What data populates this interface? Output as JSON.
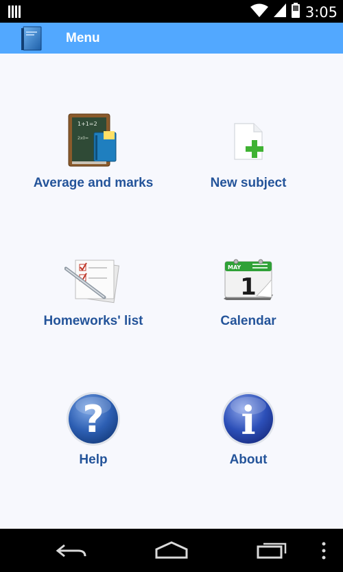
{
  "status_bar": {
    "time": "3:05",
    "icons": [
      "notification-icon",
      "wifi-icon",
      "signal-icon",
      "battery-icon"
    ]
  },
  "action_bar": {
    "title": "Menu",
    "icon": "book-icon",
    "color": "#52a8ff"
  },
  "menu": {
    "items": [
      {
        "label": "Average and marks",
        "icon": "chalkboard-icon"
      },
      {
        "label": "New subject",
        "icon": "add-document-icon"
      },
      {
        "label": "Homeworks' list",
        "icon": "checklist-icon"
      },
      {
        "label": "Calendar",
        "icon": "calendar-icon",
        "calendar_month": "MAY",
        "calendar_day": "1"
      },
      {
        "label": "Help",
        "icon": "help-icon",
        "symbol": "?"
      },
      {
        "label": "About",
        "icon": "info-icon",
        "symbol": "i"
      }
    ],
    "label_color": "#24549a"
  },
  "nav_bar": {
    "buttons": [
      "back-icon",
      "home-icon",
      "recents-icon",
      "overflow-menu-icon"
    ]
  }
}
